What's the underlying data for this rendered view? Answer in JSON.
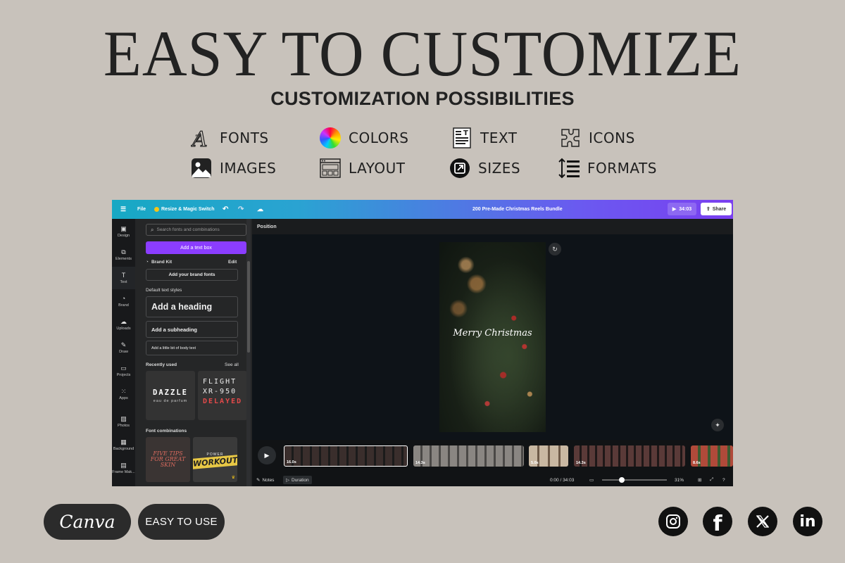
{
  "headline": "EASY TO CUSTOMIZE",
  "subheadline": "CUSTOMIZATION POSSIBILITIES",
  "features": [
    {
      "label": "FONTS",
      "icon": "font-letter-icon"
    },
    {
      "label": "COLORS",
      "icon": "color-wheel-icon"
    },
    {
      "label": "TEXT",
      "icon": "text-document-icon"
    },
    {
      "label": "ICONS",
      "icon": "puzzle-icon"
    },
    {
      "label": "IMAGES",
      "icon": "image-icon"
    },
    {
      "label": "LAYOUT",
      "icon": "layout-window-icon"
    },
    {
      "label": "SIZES",
      "icon": "resize-icon"
    },
    {
      "label": "FORMATS",
      "icon": "list-format-icon"
    }
  ],
  "editor": {
    "topbar": {
      "file": "File",
      "resize": "Resize & Magic Switch",
      "doc_title": "200 Pre-Made Christmas Reels Bundle",
      "play_time": "34:03",
      "share": "Share"
    },
    "rail": [
      "Design",
      "Elements",
      "Text",
      "Brand",
      "Uploads",
      "Draw",
      "Projects",
      "Apps",
      "Photos",
      "Background",
      "Frame Mak..."
    ],
    "panel": {
      "search_placeholder": "Search fonts and combinations",
      "add_text_box": "Add a text box",
      "brand_kit": "Brand Kit",
      "edit": "Edit",
      "add_brand_fonts": "Add your brand fonts",
      "default_styles": "Default text styles",
      "heading": "Add a heading",
      "subheading": "Add a subheading",
      "body": "Add a little bit of body text",
      "recently_used": "Recently used",
      "see_all": "See all",
      "recent_1_title": "DAZZLE",
      "recent_1_sub": "eau de parfum",
      "recent_2_line1": "FLIGHT",
      "recent_2_line2": "XR-950",
      "recent_2_line3": "DELAYED",
      "font_combinations": "Font combinations",
      "combo_1": "FIVE TIPS FOR GREAT SKIN",
      "combo_2_top": "POWER",
      "combo_2_main": "WORKOUT"
    },
    "stage": {
      "position": "Position",
      "canvas_text": "Merry Christmas",
      "clips": [
        "16.0s",
        "14.3s",
        "5.0s",
        "14.3s",
        "8.6s"
      ],
      "notes": "Notes",
      "duration": "Duration",
      "time": "0:00 / 34:03",
      "zoom": "31%"
    }
  },
  "footer": {
    "canva": "Canva",
    "easy": "EASY TO USE",
    "socials": [
      "instagram-icon",
      "facebook-icon",
      "x-icon",
      "linkedin-icon"
    ]
  }
}
